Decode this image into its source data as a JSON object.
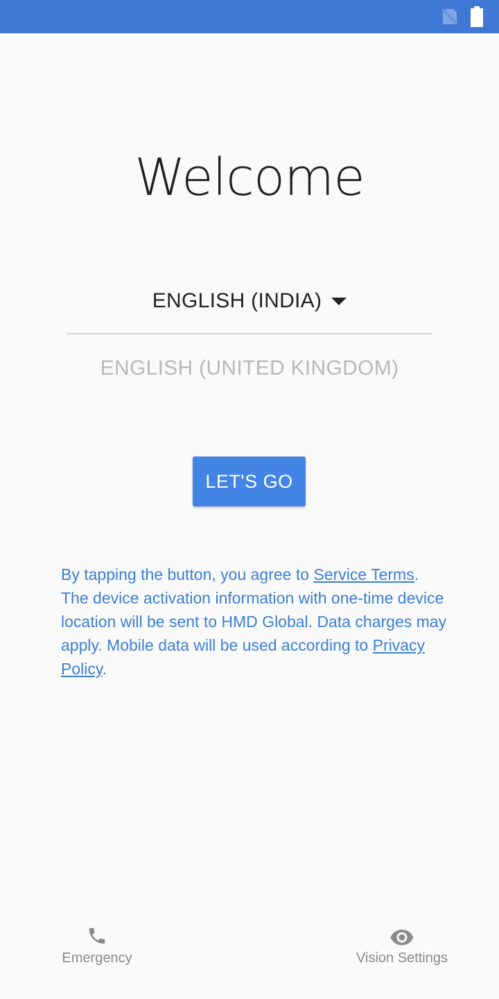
{
  "colors": {
    "status_bar": "#3f78d4",
    "accent": "#4285e4",
    "link_text": "#3b7fd6",
    "background": "#fafafa"
  },
  "status_bar": {
    "icons": [
      "no-sim-icon",
      "battery-icon"
    ]
  },
  "welcome": {
    "title": "Welcome"
  },
  "language": {
    "selected": "ENGLISH (INDIA)",
    "next_option": "ENGLISH (UNITED KINGDOM)"
  },
  "primary_button": {
    "label": "LET'S GO"
  },
  "terms": {
    "prefix": "By tapping the button, you agree to ",
    "service_terms_link": "Service Terms",
    "middle": ". The device activation information with one-time device location will be sent to HMD Global. Data charges may apply. Mobile data will be used according to ",
    "privacy_policy_link": "Privacy Policy",
    "suffix": "."
  },
  "bottom_actions": {
    "emergency": {
      "label": "Emergency",
      "icon": "phone-icon"
    },
    "vision_settings": {
      "label": "Vision Settings",
      "icon": "eye-icon"
    }
  }
}
